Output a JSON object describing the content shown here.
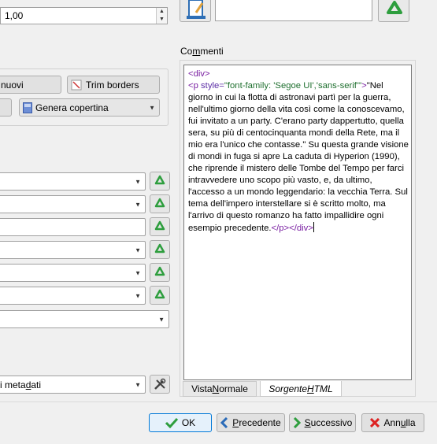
{
  "top": {
    "spin_value": "1,00"
  },
  "cover_buttons": {
    "nuovi_label": "nuovi",
    "trim_label": "Trim borders",
    "genera_label": "Genera copertina"
  },
  "metadata_combo": {
    "label_prefix": "i meta",
    "label_underlined": "d",
    "label_suffix": "ati"
  },
  "comments": {
    "label_prefix": "Co",
    "label_underlined": "m",
    "label_suffix": "menti",
    "open_div": "<div>",
    "p_open_start": "<p ",
    "p_attr": "style=",
    "p_attr_value": "\"font-family: 'Segoe UI','sans-serif'\"",
    "p_open_end": ">",
    "body_text": "\"Nel giorno in cui la flotta di astronavi partì per la guerra, nell'ultimo giorno della vita così come la conoscevamo, fui invitato a un party. C'erano party dappertutto, quella sera, su più di centocinquanta mondi della Rete, ma il mio era l'unico che contasse.\" Su questa grande visione di mondi in fuga si apre La caduta di Hyperion (1990), che riprende il mistero delle Tombe del Tempo per farci intravvedere uno scopo più vasto, e, da ultimo, l'accesso a un mondo leggendario: la vecchia Terra. Sul tema dell'impero interstellare si è scritto molto, ma l'arrivo di questo romanzo ha fatto impallidire ogni esempio precedente.",
    "close_tags": "</p></div>"
  },
  "tabs": {
    "visual_prefix": "Vista ",
    "visual_underlined": "N",
    "visual_suffix": "ormale",
    "source_prefix": "Sorgente ",
    "source_underlined": "H",
    "source_suffix": "TML"
  },
  "dialog_buttons": {
    "ok": "OK",
    "prec_underlined": "P",
    "prec_rest": "recedente",
    "succ_underlined": "S",
    "succ_rest": "uccessivo",
    "ann_prefix": "Ann",
    "ann_underlined": "u",
    "ann_suffix": "lla"
  },
  "icons": {
    "recycle": "recycle-icon",
    "edit": "edit-document-icon",
    "tools": "tools-icon",
    "check": "check-icon",
    "back": "chevron-left-icon",
    "next": "chevron-right-icon",
    "cancel": "close-icon"
  },
  "colors": {
    "tag": "#7a1fa2",
    "attr_value": "#1e6f2e",
    "recycle_green": "#2e9e3e",
    "ok_border": "#0078d7"
  }
}
